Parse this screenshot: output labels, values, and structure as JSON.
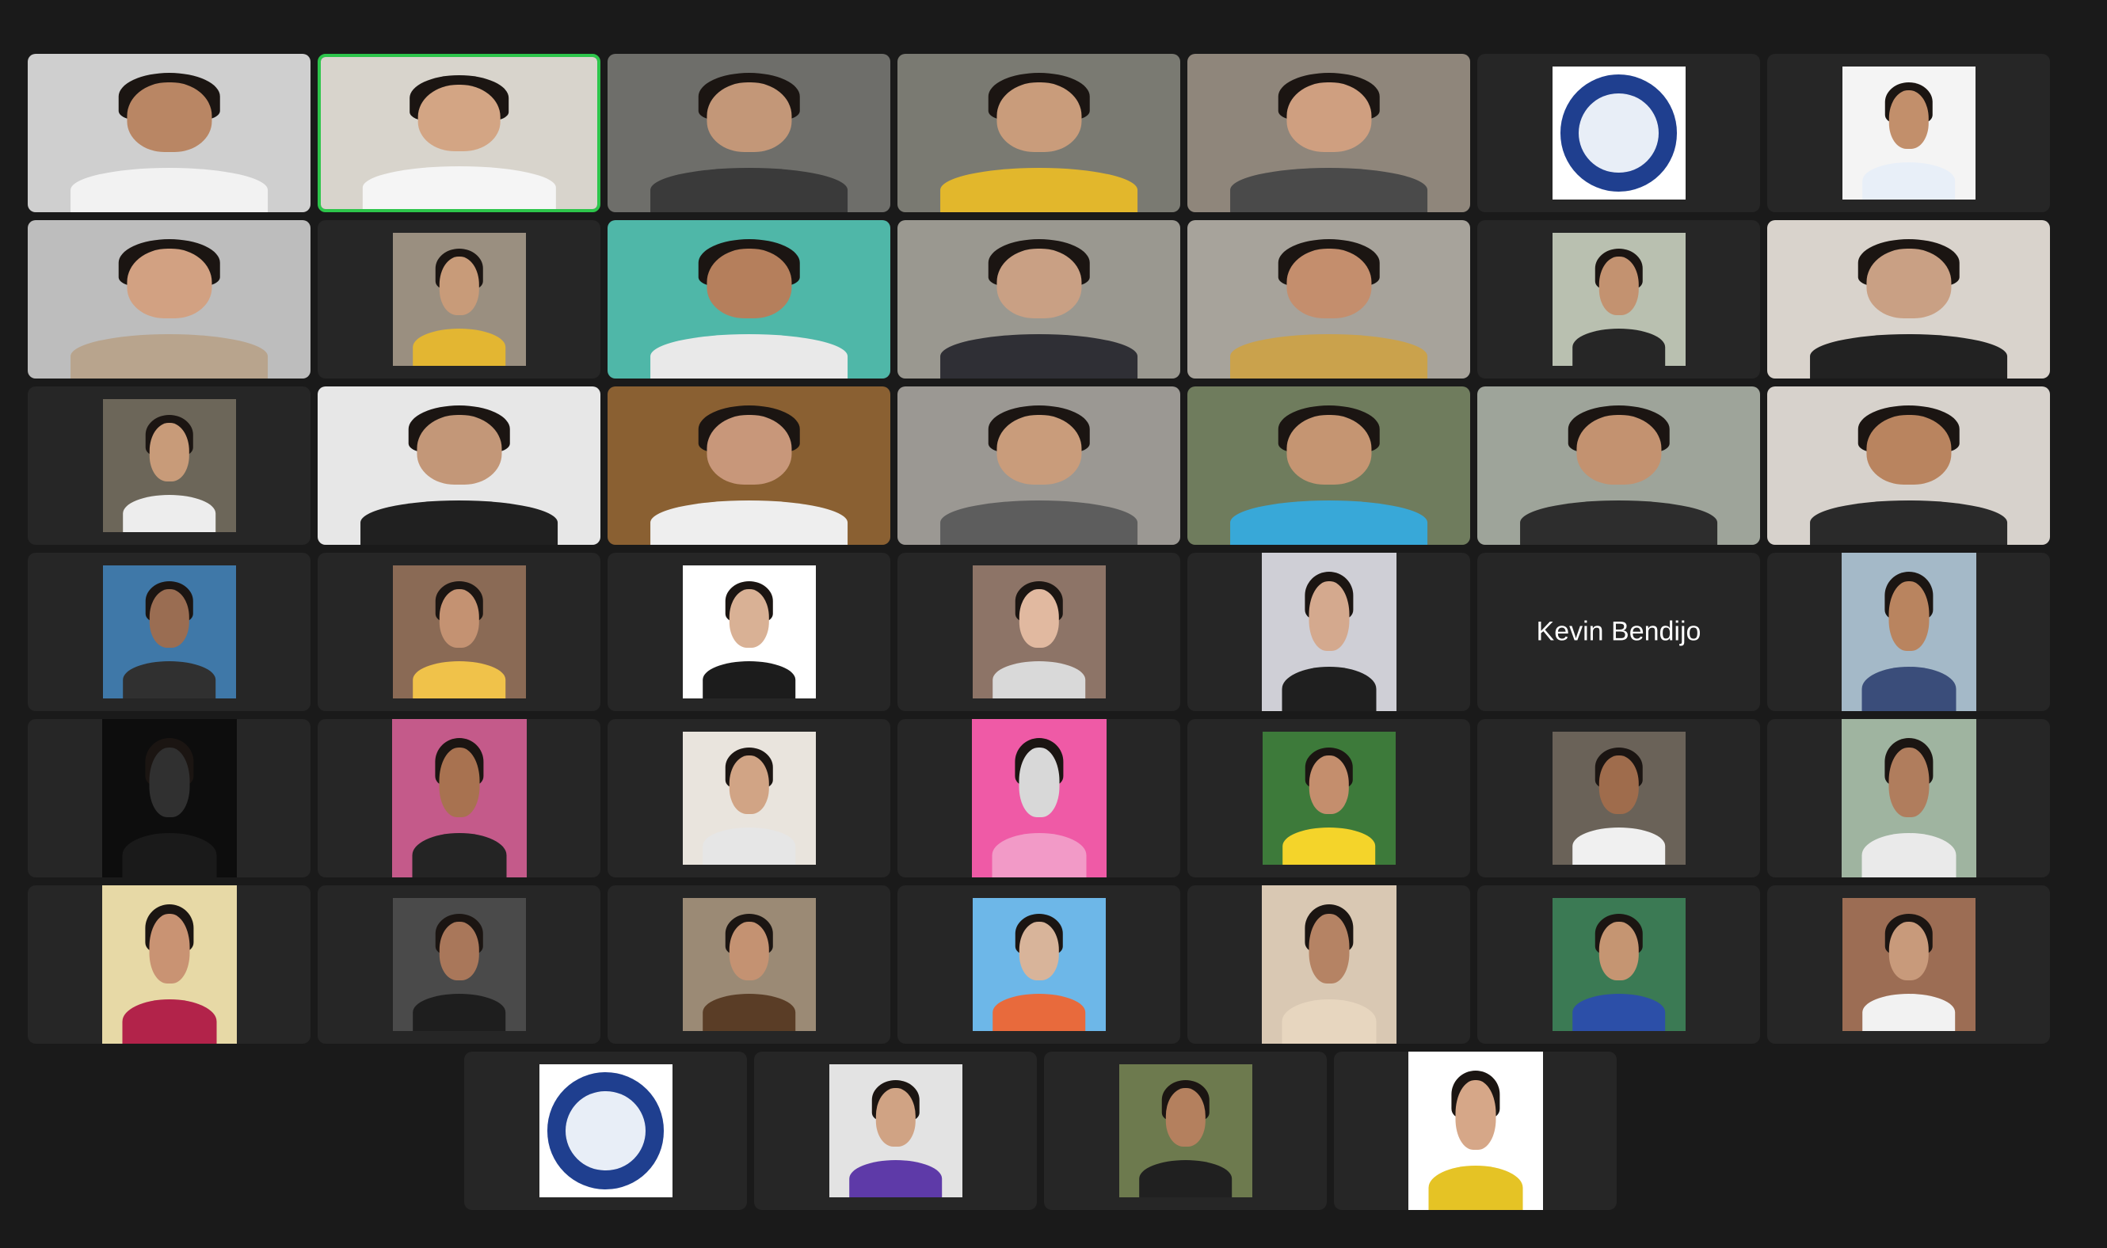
{
  "meeting": {
    "view": "gallery",
    "participant_count": 46,
    "active_speaker_border": "#2dc54b",
    "tile_background": "#262626",
    "page_background": "#1a1a1a"
  },
  "participants": [
    {
      "label": "",
      "kind": "video",
      "bg": "#cfcfcf",
      "skin": "#b98664",
      "shirt": "#f2f2f2"
    },
    {
      "label": "",
      "kind": "video",
      "bg": "#d8d4cc",
      "skin": "#d3a584",
      "shirt": "#f5f5f5",
      "active": true
    },
    {
      "label": "",
      "kind": "video",
      "bg": "#6e6e6a",
      "skin": "#c39778",
      "shirt": "#3a3a3a"
    },
    {
      "label": "",
      "kind": "video",
      "bg": "#7a7a72",
      "skin": "#c99c7b",
      "shirt": "#e2b72c"
    },
    {
      "label": "",
      "kind": "video",
      "bg": "#8f867b",
      "skin": "#cf9f80",
      "shirt": "#4a4a4a"
    },
    {
      "label": "",
      "kind": "logo"
    },
    {
      "label": "",
      "kind": "photo",
      "bg": "#f4f4f4",
      "skin": "#c28f6b",
      "shirt": "#e8eff8"
    },
    {
      "label": "",
      "kind": "video",
      "bg": "#bdbdbd",
      "skin": "#d2a182",
      "shirt": "#b8a48d"
    },
    {
      "label": "",
      "kind": "photo",
      "bg": "#9a8f80",
      "skin": "#c89b79",
      "shirt": "#e3b632"
    },
    {
      "label": "",
      "kind": "video",
      "bg": "#4fb7a8",
      "skin": "#b57f5c",
      "shirt": "#e9e9e9"
    },
    {
      "label": "",
      "kind": "video",
      "bg": "#9a9890",
      "skin": "#c9a084",
      "shirt": "#2f2f35"
    },
    {
      "label": "",
      "kind": "video",
      "bg": "#a7a39b",
      "skin": "#c48e6d",
      "shirt": "#caa24c"
    },
    {
      "label": "",
      "kind": "photo",
      "bg": "#b9c0b0",
      "skin": "#c39270",
      "shirt": "#262626"
    },
    {
      "label": "",
      "kind": "video",
      "bg": "#d9d3cc",
      "skin": "#c9a084",
      "shirt": "#222222"
    },
    {
      "label": "",
      "kind": "photo",
      "bg": "#6c6659",
      "skin": "#c89b79",
      "shirt": "#ededed"
    },
    {
      "label": "",
      "kind": "video",
      "bg": "#e7e7e7",
      "skin": "#c39778",
      "shirt": "#202020"
    },
    {
      "label": "",
      "kind": "video",
      "bg": "#8a6032",
      "skin": "#c8977a",
      "shirt": "#eeeeee"
    },
    {
      "label": "",
      "kind": "video",
      "bg": "#9b9893",
      "skin": "#c99c7b",
      "shirt": "#5d5d5d"
    },
    {
      "label": "",
      "kind": "video",
      "bg": "#6f7c5d",
      "skin": "#c59572",
      "shirt": "#38a8d8"
    },
    {
      "label": "",
      "kind": "video",
      "bg": "#9ea49a",
      "skin": "#c39270",
      "shirt": "#2d2d2d"
    },
    {
      "label": "",
      "kind": "video",
      "bg": "#d7d2cc",
      "skin": "#b9845f",
      "shirt": "#2a2a2a"
    },
    {
      "label": "",
      "kind": "photo",
      "bg": "#3f78a8",
      "skin": "#9a6d52",
      "shirt": "#303030"
    },
    {
      "label": "",
      "kind": "photo",
      "bg": "#8a6a55",
      "skin": "#c49272",
      "shirt": "#f0c24a"
    },
    {
      "label": "",
      "kind": "photo",
      "bg": "#ffffff",
      "skin": "#d9b195",
      "shirt": "#1c1c1c"
    },
    {
      "label": "",
      "kind": "photo",
      "bg": "#8d7467",
      "skin": "#e1b9a0",
      "shirt": "#d9d9d9"
    },
    {
      "label": "",
      "kind": "photo",
      "bg": "#cfcfd6",
      "skin": "#d4a98e",
      "shirt": "#1f1f1f",
      "tall": true
    },
    {
      "label": "Kevin Bendijo",
      "kind": "name"
    },
    {
      "label": "",
      "kind": "photo",
      "bg": "#a4b9c8",
      "skin": "#b9845f",
      "shirt": "#3a4d7a",
      "tall": true
    },
    {
      "label": "",
      "kind": "photo",
      "bg": "#0d0d0d",
      "skin": "#303030",
      "shirt": "#1a1a1a",
      "tall": true
    },
    {
      "label": "",
      "kind": "photo",
      "bg": "#c45a8a",
      "skin": "#a87250",
      "shirt": "#242424",
      "tall": true
    },
    {
      "label": "",
      "kind": "photo",
      "bg": "#e9e4dd",
      "skin": "#d1a485",
      "shirt": "#e6e6e6"
    },
    {
      "label": "",
      "kind": "photo",
      "bg": "#ef5aa6",
      "skin": "#d8d8d8",
      "shirt": "#f29ac7",
      "tall": true
    },
    {
      "label": "",
      "kind": "photo",
      "bg": "#3d7a3a",
      "skin": "#c48e6d",
      "shirt": "#f4d42a"
    },
    {
      "label": "",
      "kind": "photo",
      "bg": "#6a6258",
      "skin": "#9f6c4c",
      "shirt": "#f0f0f0"
    },
    {
      "label": "",
      "kind": "photo",
      "bg": "#9fb4a0",
      "skin": "#b07d5d",
      "shirt": "#eaeaea",
      "tall": true
    },
    {
      "label": "",
      "kind": "photo",
      "bg": "#e7d9a6",
      "skin": "#c99373",
      "shirt": "#b2234a",
      "tall": true
    },
    {
      "label": "",
      "kind": "photo",
      "bg": "#4a4a4a",
      "skin": "#a9775a",
      "shirt": "#1e1e1e"
    },
    {
      "label": "",
      "kind": "photo",
      "bg": "#9b8a75",
      "skin": "#c49272",
      "shirt": "#5a3d26"
    },
    {
      "label": "",
      "kind": "photo",
      "bg": "#6db7e8",
      "skin": "#d8b49a",
      "shirt": "#e86a3c"
    },
    {
      "label": "",
      "kind": "photo",
      "bg": "#d9c8b3",
      "skin": "#b58364",
      "shirt": "#e7d6bf",
      "tall": true
    },
    {
      "label": "",
      "kind": "photo",
      "bg": "#3b7a54",
      "skin": "#c59572",
      "shirt": "#2c4fa8"
    },
    {
      "label": "",
      "kind": "photo",
      "bg": "#9c6d54",
      "skin": "#c89a7b",
      "shirt": "#f2f2f2"
    },
    {
      "label": "",
      "kind": "logo"
    },
    {
      "label": "",
      "kind": "photo",
      "bg": "#e3e3e3",
      "skin": "#d0a384",
      "shirt": "#5e3aa8"
    },
    {
      "label": "",
      "kind": "photo",
      "bg": "#6d7a4e",
      "skin": "#b4805e",
      "shirt": "#202020"
    },
    {
      "label": "",
      "kind": "photo",
      "bg": "#ffffff",
      "skin": "#d6a788",
      "shirt": "#e5c325",
      "tall": true
    }
  ]
}
